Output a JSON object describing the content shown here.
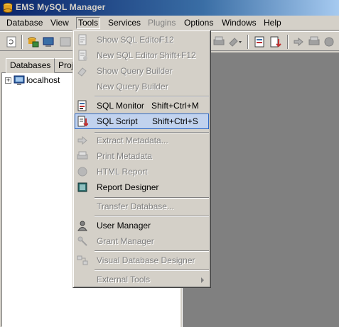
{
  "window": {
    "title": "EMS MySQL Manager"
  },
  "menubar": {
    "items": [
      {
        "label": "Database",
        "state": "normal"
      },
      {
        "label": "View",
        "state": "normal"
      },
      {
        "label": "Tools",
        "state": "open"
      },
      {
        "label": "Services",
        "state": "normal"
      },
      {
        "label": "Plugins",
        "state": "disabled"
      },
      {
        "label": "Options",
        "state": "normal"
      },
      {
        "label": "Windows",
        "state": "normal"
      },
      {
        "label": "Help",
        "state": "normal"
      }
    ]
  },
  "left_panel": {
    "tabs": [
      {
        "label": "Databases"
      },
      {
        "label": "Proje"
      }
    ],
    "tree": {
      "expander": "+",
      "node_label": "localhost"
    }
  },
  "tools_menu": {
    "items": [
      {
        "label": "Show SQL Editor",
        "shortcut": "F12",
        "enabled": false
      },
      {
        "label": "New SQL Editor",
        "shortcut": "Shift+F12",
        "enabled": false
      },
      {
        "label": "Show Query Builder",
        "shortcut": "",
        "enabled": false
      },
      {
        "label": "New Query Builder",
        "shortcut": "",
        "enabled": false
      },
      {
        "label": "SQL Monitor",
        "shortcut": "Shift+Ctrl+M",
        "enabled": true
      },
      {
        "label": "SQL Script",
        "shortcut": "Shift+Ctrl+S",
        "enabled": true,
        "highlighted": true
      },
      {
        "label": "Extract Metadata...",
        "shortcut": "",
        "enabled": false
      },
      {
        "label": "Print Metadata",
        "shortcut": "",
        "enabled": false
      },
      {
        "label": "HTML Report",
        "shortcut": "",
        "enabled": false
      },
      {
        "label": "Report Designer",
        "shortcut": "",
        "enabled": true
      },
      {
        "label": "Transfer Database...",
        "shortcut": "",
        "enabled": false
      },
      {
        "label": "User Manager",
        "shortcut": "",
        "enabled": true
      },
      {
        "label": "Grant Manager",
        "shortcut": "",
        "enabled": false
      },
      {
        "label": "Visual Database Designer",
        "shortcut": "",
        "enabled": false
      },
      {
        "label": "External Tools",
        "shortcut": "",
        "enabled": false,
        "submenu": true
      }
    ]
  },
  "colors": {
    "title_gradient_start": "#0a246a",
    "title_gradient_end": "#a6caf0",
    "face": "#d4d0c8",
    "workspace": "#808080",
    "highlight_fill": "#c1d2ee",
    "highlight_border": "#316ac5"
  }
}
